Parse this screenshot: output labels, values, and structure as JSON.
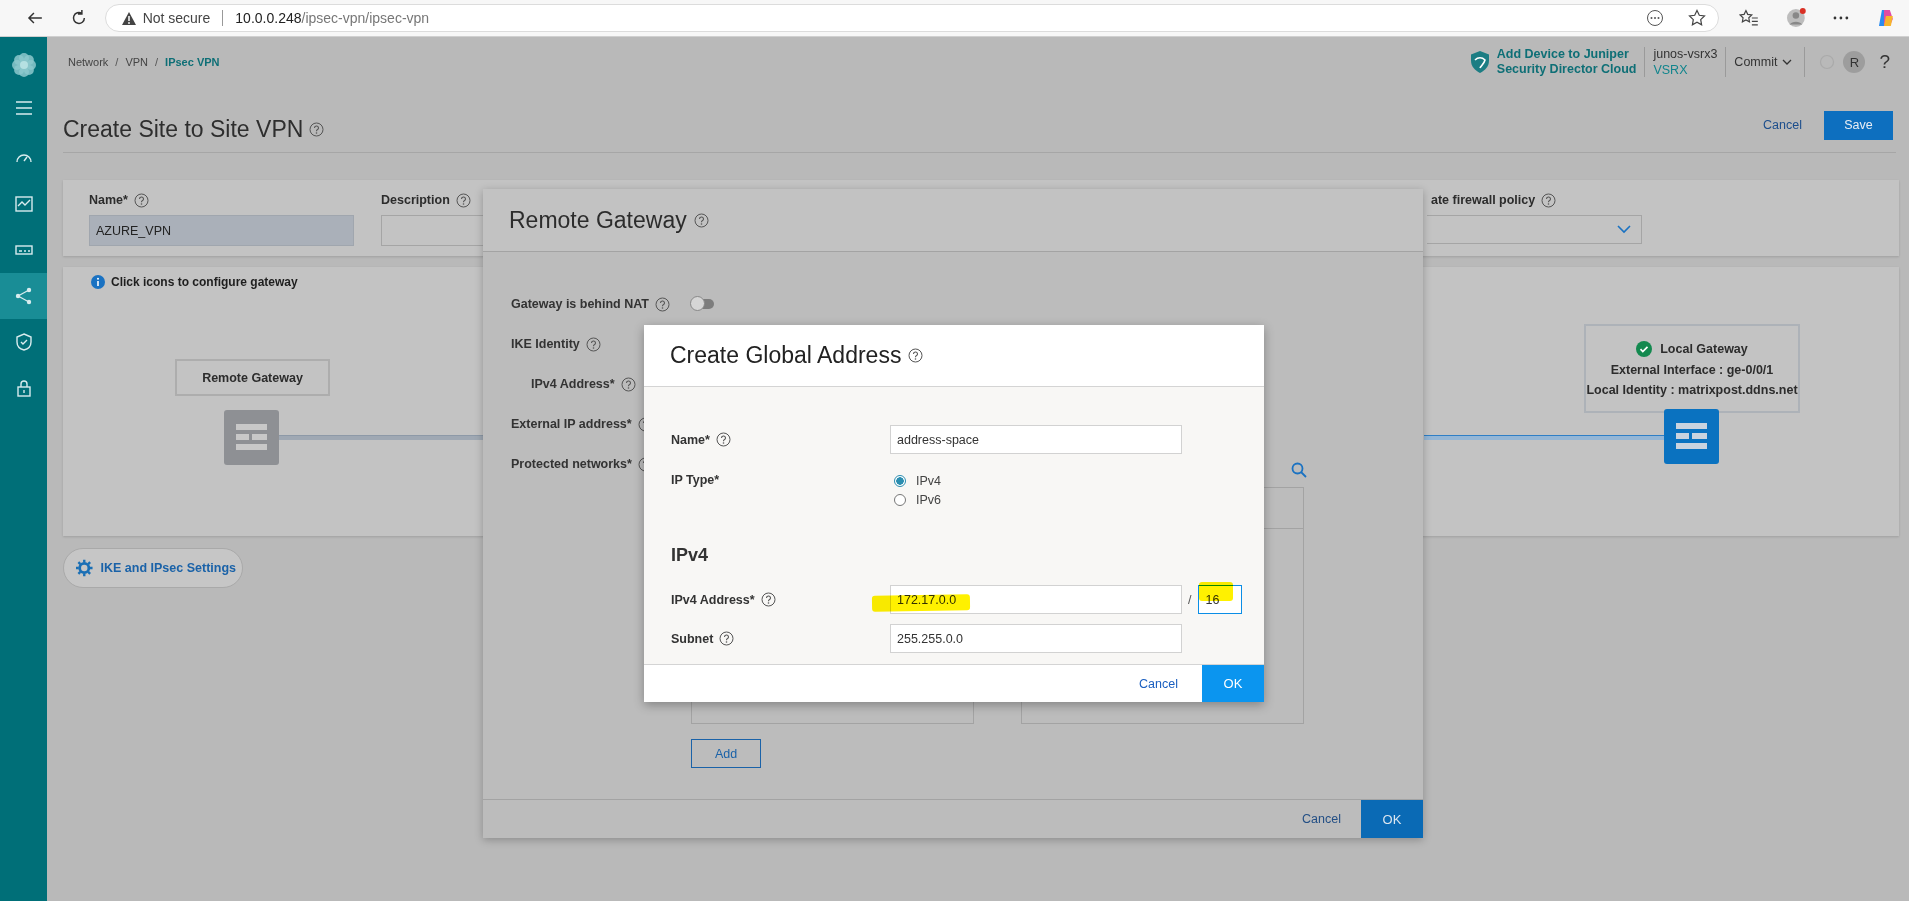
{
  "browser": {
    "security": "Not secure",
    "url_host": "10.0.0.248",
    "url_path": "/ipsec-vpn/ipsec-vpn"
  },
  "sidebar": {
    "items": [
      {
        "kind": "menu",
        "selected": false
      },
      {
        "kind": "dashboard",
        "selected": false
      },
      {
        "kind": "monitor",
        "selected": false
      },
      {
        "kind": "devices",
        "selected": false
      },
      {
        "kind": "network",
        "selected": true
      },
      {
        "kind": "shield",
        "selected": false
      },
      {
        "kind": "lock",
        "selected": false
      }
    ]
  },
  "breadcrumb": {
    "items": [
      "Network",
      "VPN",
      "IPsec VPN"
    ],
    "separator": "/"
  },
  "header": {
    "promo": [
      "Add Device to Juniper",
      "Security Director Cloud"
    ],
    "device_name": "junos-vsrx3",
    "device_model": "VSRX",
    "commit": "Commit",
    "avatar": "R",
    "help": "?"
  },
  "page": {
    "title": "Create Site to Site VPN",
    "cancel": "Cancel",
    "save": "Save"
  },
  "form": {
    "name": {
      "label": "Name*",
      "value": "AZURE_VPN"
    },
    "description": {
      "label": "Description"
    },
    "firewall_policy": {
      "label": "ate firewall policy"
    }
  },
  "topology": {
    "hint": "Click icons to configure gateway",
    "remote": {
      "label": "Remote Gateway"
    },
    "local": {
      "title": "Local Gateway",
      "configured": true,
      "lines": [
        "External Interface : ge-0/0/1",
        "Local Identity : matrixpost.ddns.net"
      ]
    }
  },
  "settings_button": "IKE and IPsec Settings",
  "remote_gateway_dialog": {
    "title": "Remote Gateway",
    "fields": [
      {
        "label": "Gateway is behind NAT",
        "kind": "toggle",
        "on": false
      },
      {
        "label": "IKE Identity",
        "kind": "heading"
      },
      {
        "label": "IPv4 Address*",
        "kind": "sub"
      },
      {
        "label": "External IP address*",
        "kind": "field"
      },
      {
        "label": "Protected networks*",
        "kind": "field"
      }
    ],
    "add": "Add",
    "cancel": "Cancel",
    "ok": "OK"
  },
  "address_dialog": {
    "title": "Create Global Address",
    "name": {
      "label": "Name*",
      "value": "address-space"
    },
    "ip_type": {
      "label": "IP Type*",
      "options": [
        {
          "label": "IPv4",
          "selected": true
        },
        {
          "label": "IPv6",
          "selected": false
        }
      ]
    },
    "section": "IPv4",
    "address": {
      "label": "IPv4 Address*",
      "value": "172.17.0.0",
      "highlighted": true
    },
    "separator": "/",
    "prefix": {
      "value": "16",
      "highlighted": true,
      "focused": true
    },
    "subnet": {
      "label": "Subnet",
      "value": "255.255.0.0"
    },
    "cancel": "Cancel",
    "ok": "OK"
  }
}
